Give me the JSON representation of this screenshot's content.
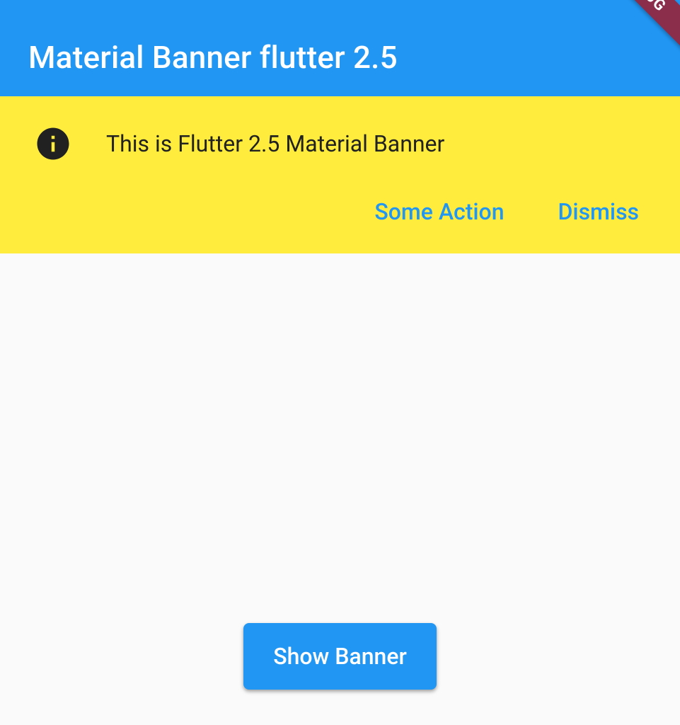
{
  "appBar": {
    "title": "Material Banner flutter 2.5"
  },
  "debugRibbon": {
    "text": "JG"
  },
  "banner": {
    "iconName": "info-icon",
    "message": "This is Flutter 2.5 Material Banner",
    "actions": {
      "someAction": "Some Action",
      "dismiss": "Dismiss"
    }
  },
  "main": {
    "showBannerButton": "Show Banner"
  },
  "colors": {
    "primary": "#2196f3",
    "bannerBg": "#ffec3d",
    "debugRibbon": "#8a2e4c"
  }
}
